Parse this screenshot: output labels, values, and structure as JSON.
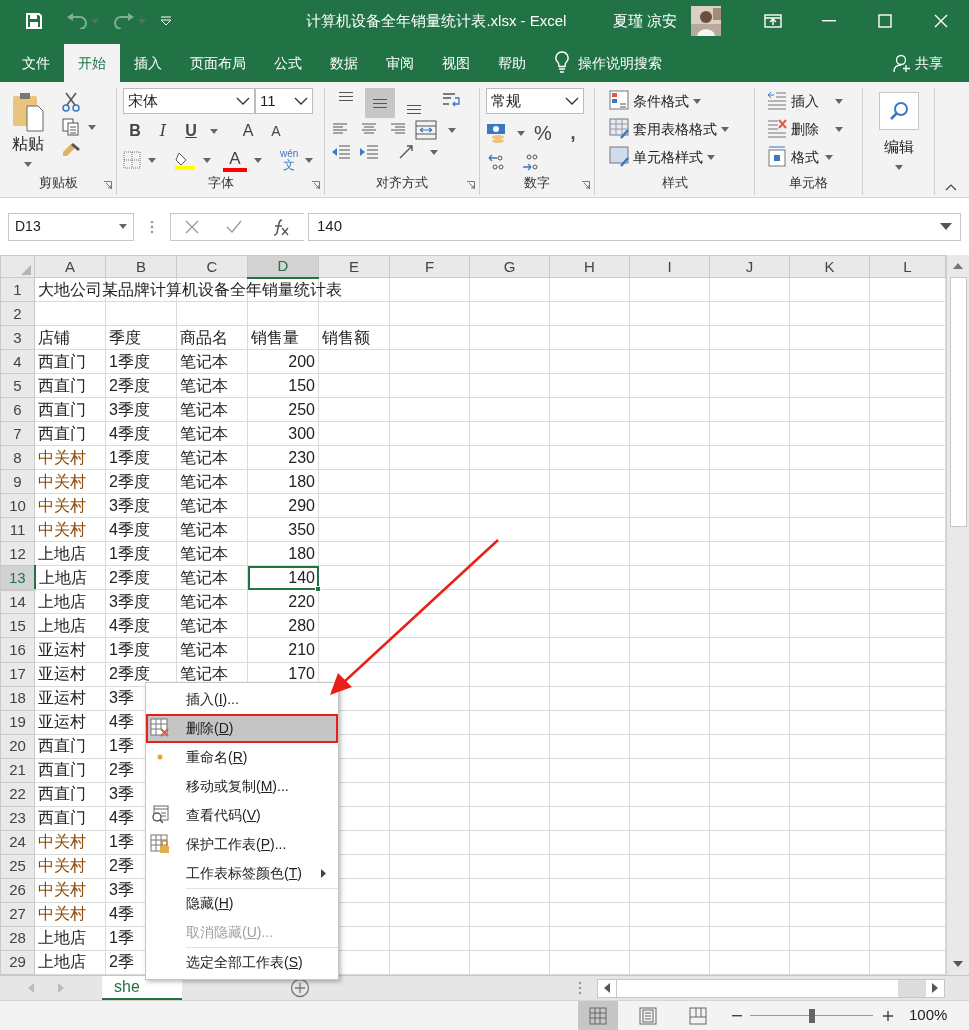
{
  "window": {
    "title": "计算机设备全年销量统计表.xlsx  -  Excel",
    "user": "夏瑾 凉安"
  },
  "tabs": [
    {
      "label": "文件",
      "selected": false
    },
    {
      "label": "开始",
      "selected": true
    },
    {
      "label": "插入",
      "selected": false
    },
    {
      "label": "页面布局",
      "selected": false
    },
    {
      "label": "公式",
      "selected": false
    },
    {
      "label": "数据",
      "selected": false
    },
    {
      "label": "审阅",
      "selected": false
    },
    {
      "label": "视图",
      "selected": false
    },
    {
      "label": "帮助",
      "selected": false
    }
  ],
  "tell_me": "操作说明搜索",
  "share": "共享",
  "ribbon": {
    "clipboard": {
      "paste": "粘贴",
      "label": "剪贴板"
    },
    "font": {
      "name": "宋体",
      "size": "11",
      "bold": "B",
      "italic": "I",
      "underline": "U",
      "grow": "A",
      "shrink": "A",
      "font_color": "A",
      "phonetic_top": "wén",
      "phonetic": "文",
      "label": "字体"
    },
    "alignment": {
      "vertical": [
        {
          "selected": false
        },
        {
          "selected": true
        },
        {
          "selected": false
        }
      ],
      "label": "对齐方式"
    },
    "number": {
      "format": "常规",
      "percent": "%",
      "comma": ",",
      "label": "数字"
    },
    "styles": {
      "items": [
        "条件格式",
        "套用表格格式",
        "单元格样式"
      ],
      "label": "样式"
    },
    "cells": {
      "items": [
        "插入",
        "删除",
        "格式"
      ],
      "label": "单元格"
    },
    "editing": {
      "label": "编辑"
    }
  },
  "formula_bar": {
    "name_box": "D13",
    "formula": "140"
  },
  "columns": [
    {
      "label": "A",
      "selected": false
    },
    {
      "label": "B",
      "selected": false
    },
    {
      "label": "C",
      "selected": false
    },
    {
      "label": "D",
      "selected": true
    },
    {
      "label": "E",
      "selected": false
    },
    {
      "label": "F",
      "selected": false
    },
    {
      "label": "G",
      "selected": false
    },
    {
      "label": "H",
      "selected": false
    },
    {
      "label": "I",
      "selected": false
    },
    {
      "label": "J",
      "selected": false
    },
    {
      "label": "K",
      "selected": false
    },
    {
      "label": "L",
      "selected": false
    }
  ],
  "rows": [
    {
      "number": "1",
      "selected": false,
      "cells": {
        "A": {
          "text": "大地公司某品牌计算机设备全年销量统计表"
        }
      }
    },
    {
      "number": "2",
      "selected": false
    },
    {
      "number": "3",
      "selected": false,
      "cells": {
        "A": {
          "text": "店铺"
        },
        "B": {
          "text": "季度"
        },
        "C": {
          "text": "商品名"
        },
        "D": {
          "text": "销售量"
        },
        "E": {
          "text": "销售额"
        }
      }
    },
    {
      "number": "4",
      "selected": false,
      "cells": {
        "A": {
          "text": "西直门"
        },
        "B": {
          "text": "1季度"
        },
        "C": {
          "text": "笔记本"
        },
        "D": {
          "text": "200",
          "kind": "number"
        }
      }
    },
    {
      "number": "5",
      "selected": false,
      "cells": {
        "A": {
          "text": "西直门"
        },
        "B": {
          "text": "2季度"
        },
        "C": {
          "text": "笔记本"
        },
        "D": {
          "text": "150",
          "kind": "number"
        }
      }
    },
    {
      "number": "6",
      "selected": false,
      "cells": {
        "A": {
          "text": "西直门"
        },
        "B": {
          "text": "3季度"
        },
        "C": {
          "text": "笔记本"
        },
        "D": {
          "text": "250",
          "kind": "number"
        }
      }
    },
    {
      "number": "7",
      "selected": false,
      "cells": {
        "A": {
          "text": "西直门"
        },
        "B": {
          "text": "4季度"
        },
        "C": {
          "text": "笔记本"
        },
        "D": {
          "text": "300",
          "kind": "number"
        }
      }
    },
    {
      "number": "8",
      "selected": false,
      "cells": {
        "A": {
          "text": "中关村",
          "color": "#8a4a05"
        },
        "B": {
          "text": "1季度"
        },
        "C": {
          "text": "笔记本"
        },
        "D": {
          "text": "230",
          "kind": "number"
        }
      }
    },
    {
      "number": "9",
      "selected": false,
      "cells": {
        "A": {
          "text": "中关村",
          "color": "#8a4a05"
        },
        "B": {
          "text": "2季度"
        },
        "C": {
          "text": "笔记本"
        },
        "D": {
          "text": "180",
          "kind": "number"
        }
      }
    },
    {
      "number": "10",
      "selected": false,
      "cells": {
        "A": {
          "text": "中关村",
          "color": "#8a4a05"
        },
        "B": {
          "text": "3季度"
        },
        "C": {
          "text": "笔记本"
        },
        "D": {
          "text": "290",
          "kind": "number"
        }
      }
    },
    {
      "number": "11",
      "selected": false,
      "cells": {
        "A": {
          "text": "中关村",
          "color": "#8a4a05"
        },
        "B": {
          "text": "4季度"
        },
        "C": {
          "text": "笔记本"
        },
        "D": {
          "text": "350",
          "kind": "number"
        }
      }
    },
    {
      "number": "12",
      "selected": false,
      "cells": {
        "A": {
          "text": "上地店"
        },
        "B": {
          "text": "1季度"
        },
        "C": {
          "text": "笔记本"
        },
        "D": {
          "text": "180",
          "kind": "number"
        }
      }
    },
    {
      "number": "13",
      "selected": true,
      "cells": {
        "A": {
          "text": "上地店"
        },
        "B": {
          "text": "2季度"
        },
        "C": {
          "text": "笔记本"
        },
        "D": {
          "text": "140",
          "kind": "number",
          "selected": true
        }
      }
    },
    {
      "number": "14",
      "selected": false,
      "cells": {
        "A": {
          "text": "上地店"
        },
        "B": {
          "text": "3季度"
        },
        "C": {
          "text": "笔记本"
        },
        "D": {
          "text": "220",
          "kind": "number"
        }
      }
    },
    {
      "number": "15",
      "selected": false,
      "cells": {
        "A": {
          "text": "上地店"
        },
        "B": {
          "text": "4季度"
        },
        "C": {
          "text": "笔记本"
        },
        "D": {
          "text": "280",
          "kind": "number"
        }
      }
    },
    {
      "number": "16",
      "selected": false,
      "cells": {
        "A": {
          "text": "亚运村"
        },
        "B": {
          "text": "1季度"
        },
        "C": {
          "text": "笔记本"
        },
        "D": {
          "text": "210",
          "kind": "number"
        }
      }
    },
    {
      "number": "17",
      "selected": false,
      "cells": {
        "A": {
          "text": "亚运村"
        },
        "B": {
          "text": "2季度"
        },
        "C": {
          "text": "笔记本"
        },
        "D": {
          "text": "170",
          "kind": "number"
        }
      }
    },
    {
      "number": "18",
      "selected": false,
      "cells": {
        "A": {
          "text": "亚运村"
        },
        "B": {
          "text": "3季"
        }
      }
    },
    {
      "number": "19",
      "selected": false,
      "cells": {
        "A": {
          "text": "亚运村"
        },
        "B": {
          "text": "4季"
        }
      }
    },
    {
      "number": "20",
      "selected": false,
      "cells": {
        "A": {
          "text": "西直门"
        },
        "B": {
          "text": "1季"
        }
      }
    },
    {
      "number": "21",
      "selected": false,
      "cells": {
        "A": {
          "text": "西直门"
        },
        "B": {
          "text": "2季"
        }
      }
    },
    {
      "number": "22",
      "selected": false,
      "cells": {
        "A": {
          "text": "西直门"
        },
        "B": {
          "text": "3季"
        }
      }
    },
    {
      "number": "23",
      "selected": false,
      "cells": {
        "A": {
          "text": "西直门"
        },
        "B": {
          "text": "4季"
        }
      }
    },
    {
      "number": "24",
      "selected": false,
      "cells": {
        "A": {
          "text": "中关村",
          "color": "#8a4a05"
        },
        "B": {
          "text": "1季"
        }
      }
    },
    {
      "number": "25",
      "selected": false,
      "cells": {
        "A": {
          "text": "中关村",
          "color": "#8a4a05"
        },
        "B": {
          "text": "2季"
        }
      }
    },
    {
      "number": "26",
      "selected": false,
      "cells": {
        "A": {
          "text": "中关村",
          "color": "#8a4a05"
        },
        "B": {
          "text": "3季"
        }
      }
    },
    {
      "number": "27",
      "selected": false,
      "cells": {
        "A": {
          "text": "中关村",
          "color": "#8a4a05"
        },
        "B": {
          "text": "4季"
        }
      }
    },
    {
      "number": "28",
      "selected": false,
      "cells": {
        "A": {
          "text": "上地店"
        },
        "B": {
          "text": "1季"
        }
      }
    },
    {
      "number": "29",
      "selected": false,
      "cells": {
        "A": {
          "text": "上地店"
        },
        "B": {
          "text": "2季"
        }
      }
    }
  ],
  "sheet_tabs": [
    {
      "label": "she",
      "selected": true
    }
  ],
  "context_menu": {
    "items": [
      {
        "label": "插入(I)...",
        "kind": "plain",
        "selected": false,
        "outlined": false,
        "disabled": false,
        "submenu": false,
        "separator_before": false
      },
      {
        "label": "删除(D)",
        "kind": "delete",
        "selected": true,
        "outlined": true,
        "disabled": false,
        "submenu": false,
        "separator_before": false
      },
      {
        "label": "重命名(R)",
        "kind": "rename",
        "selected": false,
        "outlined": false,
        "disabled": false,
        "submenu": false,
        "separator_before": false
      },
      {
        "label": "移动或复制(M)...",
        "kind": "plain",
        "selected": false,
        "outlined": false,
        "disabled": false,
        "submenu": false,
        "separator_before": false
      },
      {
        "label": "查看代码(V)",
        "kind": "code",
        "selected": false,
        "outlined": false,
        "disabled": false,
        "submenu": false,
        "separator_before": false
      },
      {
        "label": "保护工作表(P)...",
        "kind": "protect",
        "selected": false,
        "outlined": false,
        "disabled": false,
        "submenu": false,
        "separator_before": false
      },
      {
        "label": "工作表标签颜色(T)",
        "kind": "plain",
        "selected": false,
        "outlined": false,
        "disabled": false,
        "submenu": true,
        "separator_before": false
      },
      {
        "label": "隐藏(H)",
        "kind": "plain",
        "selected": false,
        "outlined": false,
        "disabled": false,
        "submenu": false,
        "separator_before": true
      },
      {
        "label": "取消隐藏(U)...",
        "kind": "plain",
        "selected": false,
        "outlined": false,
        "disabled": true,
        "submenu": false,
        "separator_before": false
      },
      {
        "label": "选定全部工作表(S)",
        "kind": "plain",
        "selected": false,
        "outlined": false,
        "disabled": false,
        "submenu": false,
        "separator_before": true
      }
    ]
  },
  "pointer_arrow": true,
  "status_bar": {
    "views": [
      {
        "kind": "normal",
        "selected": true
      },
      {
        "kind": "page_layout",
        "selected": false
      },
      {
        "kind": "page_break",
        "selected": false
      }
    ],
    "zoom": {
      "level": 0.5,
      "reading": "100%"
    }
  }
}
